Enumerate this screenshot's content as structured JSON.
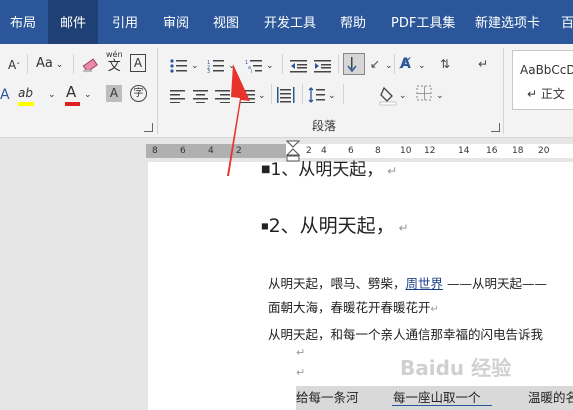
{
  "tabs": [
    "布局",
    "邮件",
    "引用",
    "审阅",
    "视图",
    "开发工具",
    "帮助",
    "PDF工具集",
    "新建选项卡",
    "百"
  ],
  "active_tab": "邮件",
  "ribbon": {
    "font_size_label": "A",
    "case_label": "Aa",
    "phonetic_label": "wén",
    "char_border_label": "A",
    "highlight_label": "ab",
    "font_color_label": "A",
    "shading_label": "A",
    "enclose_label": "字",
    "paragraph_group": "段落",
    "style_preview": "AaBbCcD",
    "style_name": "↵ 正文"
  },
  "ruler": {
    "left_numbers": [
      "8",
      "6",
      "4",
      "2"
    ],
    "right_numbers": [
      "2",
      "4",
      "6",
      "8",
      "10",
      "12",
      "14",
      "16",
      "18",
      "20"
    ]
  },
  "document": {
    "heading1": "1、从明天起，",
    "heading2": "2、从明天起，",
    "para1_a": "从明天起，喂马、劈柴，",
    "para1_link": "周世界",
    "para1_b": " ——从明天起——",
    "para2": "面朝大海，春暖花开春暖花开",
    "para3": "从明天起，和每一个亲人通信那幸福的闪电告诉我",
    "row_a": "给每一条河",
    "row_b": "每一座山取一个",
    "row_c": "温暖的名"
  },
  "watermark": "Baidu 经验",
  "colors": {
    "tab_bar": "#2b579a",
    "active_tab": "#1e4074",
    "arrow": "#e8322c",
    "highlight": "#ffff00",
    "font_color": "#e02020"
  }
}
